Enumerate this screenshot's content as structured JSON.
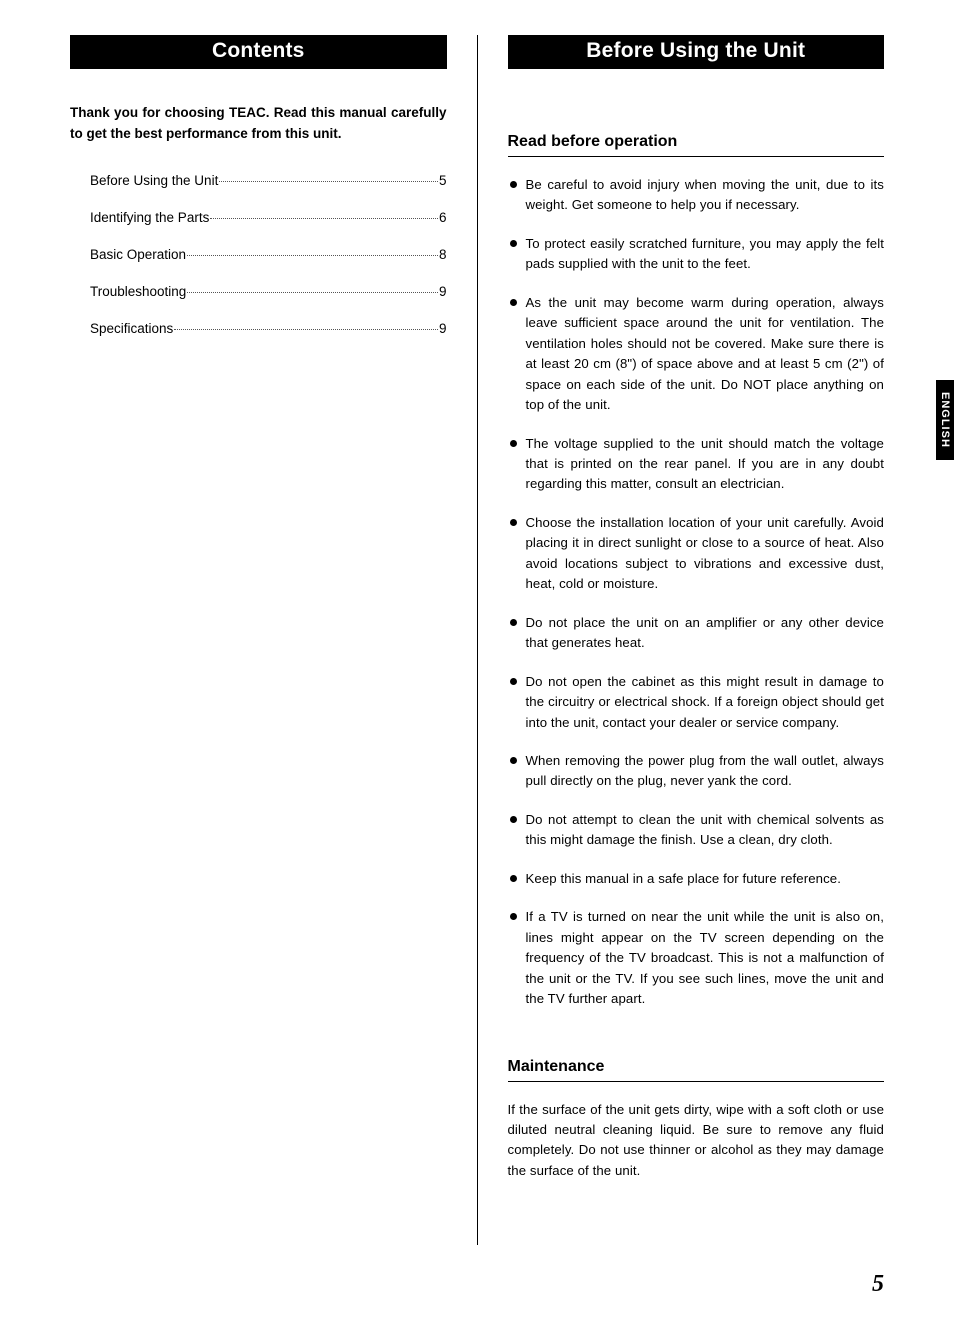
{
  "left": {
    "heading": "Contents",
    "intro": "Thank you for choosing TEAC. Read this manual carefully to get the best performance from this unit.",
    "toc": [
      {
        "title": "Before Using the Unit",
        "page": "5"
      },
      {
        "title": "Identifying the Parts ",
        "page": "6"
      },
      {
        "title": "Basic Operation ",
        "page": "8"
      },
      {
        "title": "Troubleshooting",
        "page": "9"
      },
      {
        "title": "Specifications ",
        "page": "9"
      }
    ]
  },
  "right": {
    "heading": "Before Using the Unit",
    "sub1": "Read before operation",
    "bullets": [
      "Be careful to avoid injury when moving the unit, due to its weight. Get someone to help you if necessary.",
      "To protect easily scratched furniture, you may apply the felt pads supplied with the unit to the feet.",
      "As the unit may become warm during operation, always leave sufficient space around the unit for ventilation. The ventilation holes should not be covered. Make sure there is at least 20 cm (8\") of space above and at least 5 cm (2\") of space on each side of the unit. Do NOT place anything on top of the unit.",
      "The voltage supplied to the unit should match the voltage that is printed on the rear panel. If you are in any doubt regarding this matter, consult an electrician.",
      "Choose the installation location of your unit carefully. Avoid placing it in direct sunlight or close to a source of heat. Also avoid locations subject to vibrations and excessive dust, heat, cold or moisture.",
      "Do not place the unit on an amplifier or any other device that generates heat.",
      "Do not open the cabinet as this might result in damage to the circuitry or electrical shock. If a foreign object should get into the unit, contact your dealer or service company.",
      "When removing the power plug from the wall outlet, always pull directly on the plug, never yank the cord.",
      "Do not attempt to clean the unit with chemical solvents as this might damage the finish. Use a clean, dry cloth.",
      "Keep this manual in a safe place for future reference.",
      "If a TV is turned on near the unit while the unit is also on, lines might appear on the TV screen depending on the frequency of the TV broadcast. This is not a malfunction of the unit or the TV. If you see such lines, move the unit and the TV further apart."
    ],
    "sub2": "Maintenance",
    "maintenance_text": "If the surface of the unit gets dirty, wipe with a soft cloth or use diluted neutral cleaning liquid. Be sure to remove any fluid completely. Do not use thinner or alcohol as they may damage the surface of the unit."
  },
  "side_tab": "ENGLISH",
  "page_number": "5"
}
